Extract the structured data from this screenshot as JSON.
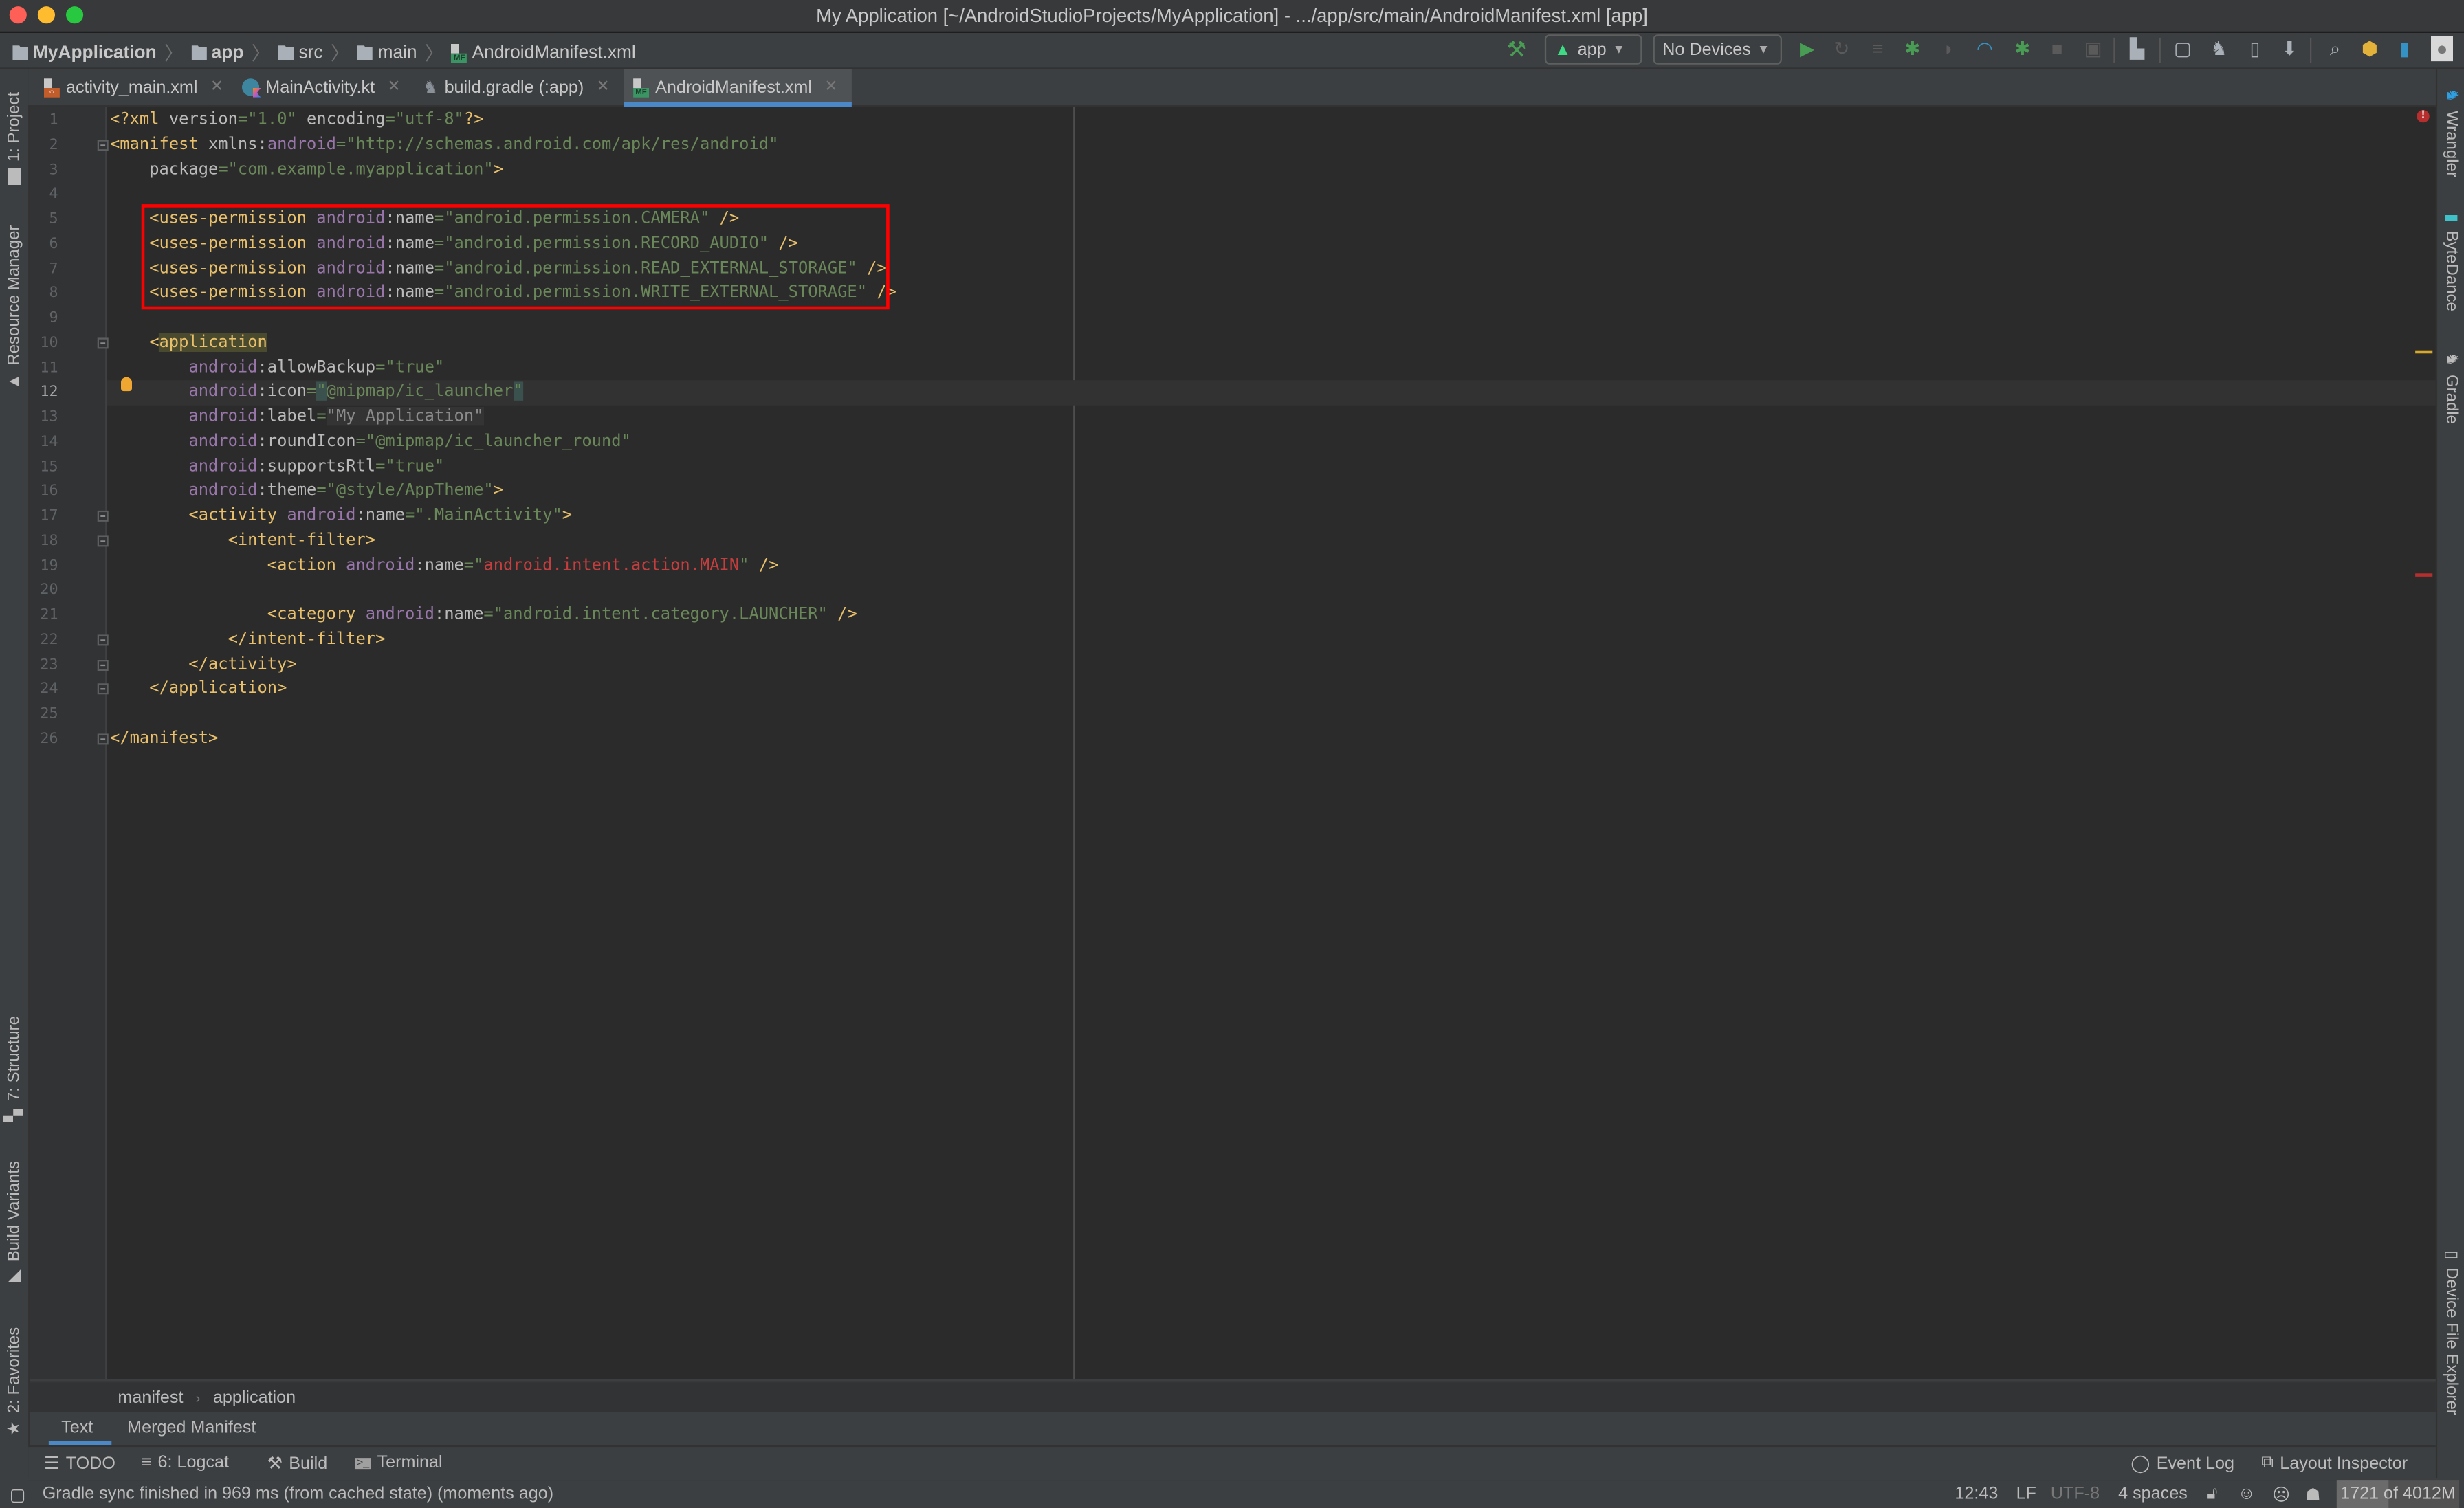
{
  "window": {
    "title": "My Application [~/AndroidStudioProjects/MyApplication] - .../app/src/main/AndroidManifest.xml [app]"
  },
  "navbar": {
    "breadcrumbs": [
      "MyApplication",
      "app",
      "src",
      "main",
      "AndroidManifest.xml"
    ],
    "run_config": "app",
    "device": "No Devices",
    "toolbar_icons": [
      "make-project-icon",
      "run-icon",
      "apply-changes-icon",
      "apply-code-changes-icon",
      "debug-icon",
      "run-with-coverage-icon",
      "profile-icon",
      "attach-debugger-icon",
      "stop-icon",
      "avd-manager-sdk-icon",
      "project-structure-icon",
      "avd-manager-icon",
      "sync-gradle-icon",
      "device-manager-icon",
      "sdk-manager-icon",
      "search-everywhere-icon",
      "plugin-icon",
      "bytedance-icon",
      "user-icon"
    ]
  },
  "tabs": [
    {
      "label": "activity_main.xml",
      "icon": "xml-file-icon",
      "active": false
    },
    {
      "label": "MainActivity.kt",
      "icon": "kotlin-file-icon",
      "active": false
    },
    {
      "label": "build.gradle (:app)",
      "icon": "gradle-file-icon",
      "active": false
    },
    {
      "label": "AndroidManifest.xml",
      "icon": "manifest-file-icon",
      "active": true
    }
  ],
  "left_tool_windows": [
    "1: Project",
    "Resource Manager",
    "7: Structure",
    "Build Variants",
    "2: Favorites"
  ],
  "right_tool_windows": [
    "Wrangler",
    "ByteDance",
    "Gradle",
    "Device File Explorer"
  ],
  "editor": {
    "current_line": 12,
    "lines": [
      {
        "n": 1,
        "tokens": [
          [
            "t-tag",
            "<?xml "
          ],
          [
            "t-attr",
            "version"
          ],
          [
            "t-val",
            "=\"1.0\""
          ],
          [
            "t-attr",
            " encoding"
          ],
          [
            "t-val",
            "=\"utf-8\""
          ],
          [
            "t-tag",
            "?>"
          ]
        ]
      },
      {
        "n": 2,
        "tokens": [
          [
            "t-tag",
            "<manifest "
          ],
          [
            "t-attr",
            "xmlns:"
          ],
          [
            "t-ns",
            "android"
          ],
          [
            "t-val",
            "=\"http://schemas.android.com/apk/res/android\""
          ]
        ]
      },
      {
        "n": 3,
        "tokens": [
          [
            "t-attr",
            "    package"
          ],
          [
            "t-val",
            "=\"com.example.myapplication\""
          ],
          [
            "t-tag",
            ">"
          ]
        ]
      },
      {
        "n": 4,
        "tokens": []
      },
      {
        "n": 5,
        "tokens": [
          [
            "t-tag",
            "    <uses-permission "
          ],
          [
            "t-ns",
            "android"
          ],
          [
            "t-attr",
            ":name"
          ],
          [
            "t-val",
            "=\"android.permission.CAMERA\""
          ],
          [
            "t-tag",
            " />"
          ]
        ]
      },
      {
        "n": 6,
        "tokens": [
          [
            "t-tag",
            "    <uses-permission "
          ],
          [
            "t-ns",
            "android"
          ],
          [
            "t-attr",
            ":name"
          ],
          [
            "t-val",
            "=\"android.permission.RECORD_AUDIO\""
          ],
          [
            "t-tag",
            " />"
          ]
        ]
      },
      {
        "n": 7,
        "tokens": [
          [
            "t-tag",
            "    <uses-permission "
          ],
          [
            "t-ns",
            "android"
          ],
          [
            "t-attr",
            ":name"
          ],
          [
            "t-val",
            "=\"android.permission.READ_EXTERNAL_STORAGE\""
          ],
          [
            "t-tag",
            " />"
          ]
        ]
      },
      {
        "n": 8,
        "tokens": [
          [
            "t-tag",
            "    <uses-permission "
          ],
          [
            "t-ns",
            "android"
          ],
          [
            "t-attr",
            ":name"
          ],
          [
            "t-val",
            "=\"android.permission.WRITE_EXTERNAL_STORAGE\""
          ],
          [
            "t-tag",
            " />"
          ]
        ]
      },
      {
        "n": 9,
        "tokens": []
      },
      {
        "n": 10,
        "tokens": [
          [
            "t-tag",
            "    <"
          ],
          [
            "t-tag t-hl",
            "application"
          ]
        ]
      },
      {
        "n": 11,
        "tokens": [
          [
            "t-ns",
            "        android"
          ],
          [
            "t-attr",
            ":allowBackup"
          ],
          [
            "t-val",
            "=\"true\""
          ]
        ]
      },
      {
        "n": 12,
        "tokens": [
          [
            "t-ns",
            "        android"
          ],
          [
            "t-attr",
            ":icon"
          ],
          [
            "t-val",
            "="
          ],
          [
            "t-val t-sel",
            "\""
          ],
          [
            "t-val",
            "@mipmap/ic_launcher"
          ],
          [
            "t-val t-sel",
            "\""
          ]
        ]
      },
      {
        "n": 13,
        "tokens": [
          [
            "t-ns",
            "        android"
          ],
          [
            "t-attr",
            ":label"
          ],
          [
            "t-val",
            "="
          ],
          [
            "t-lbl",
            "\"My Application\""
          ]
        ]
      },
      {
        "n": 14,
        "tokens": [
          [
            "t-ns",
            "        android"
          ],
          [
            "t-attr",
            ":roundIcon"
          ],
          [
            "t-val",
            "=\"@mipmap/ic_launcher_round\""
          ]
        ]
      },
      {
        "n": 15,
        "tokens": [
          [
            "t-ns",
            "        android"
          ],
          [
            "t-attr",
            ":supportsRtl"
          ],
          [
            "t-val",
            "=\"true\""
          ]
        ]
      },
      {
        "n": 16,
        "tokens": [
          [
            "t-ns",
            "        android"
          ],
          [
            "t-attr",
            ":theme"
          ],
          [
            "t-val",
            "=\"@style/AppTheme\""
          ],
          [
            "t-tag",
            ">"
          ]
        ]
      },
      {
        "n": 17,
        "tokens": [
          [
            "t-tag",
            "        <activity "
          ],
          [
            "t-ns",
            "android"
          ],
          [
            "t-attr",
            ":name"
          ],
          [
            "t-val",
            "=\".MainActivity\""
          ],
          [
            "t-tag",
            ">"
          ]
        ]
      },
      {
        "n": 18,
        "tokens": [
          [
            "t-tag",
            "            <intent-filter>"
          ]
        ]
      },
      {
        "n": 19,
        "tokens": [
          [
            "t-tag",
            "                <action "
          ],
          [
            "t-ns",
            "android"
          ],
          [
            "t-attr",
            ":name"
          ],
          [
            "t-val",
            "=\""
          ],
          [
            "t-err",
            "android.intent.action.MAIN"
          ],
          [
            "t-val",
            "\""
          ],
          [
            "t-tag",
            " />"
          ]
        ]
      },
      {
        "n": 20,
        "tokens": []
      },
      {
        "n": 21,
        "tokens": [
          [
            "t-tag",
            "                <category "
          ],
          [
            "t-ns",
            "android"
          ],
          [
            "t-attr",
            ":name"
          ],
          [
            "t-val",
            "=\"android.intent.category.LAUNCHER\""
          ],
          [
            "t-tag",
            " />"
          ]
        ]
      },
      {
        "n": 22,
        "tokens": [
          [
            "t-tag",
            "            </intent-filter>"
          ]
        ]
      },
      {
        "n": 23,
        "tokens": [
          [
            "t-tag",
            "        </activity>"
          ]
        ]
      },
      {
        "n": 24,
        "tokens": [
          [
            "t-tag",
            "    </application>"
          ]
        ]
      },
      {
        "n": 25,
        "tokens": []
      },
      {
        "n": 26,
        "tokens": [
          [
            "t-tag",
            "</manifest>"
          ]
        ]
      }
    ],
    "fold_lines": [
      2,
      10,
      17,
      18,
      22,
      23,
      24,
      26
    ],
    "highlight_box_lines": [
      5,
      8
    ]
  },
  "editor_breadcrumb": [
    "manifest",
    "application"
  ],
  "subtabs": [
    {
      "label": "Text",
      "active": true
    },
    {
      "label": "Merged Manifest",
      "active": false
    }
  ],
  "tool_buttons_left": [
    {
      "label": "TODO",
      "icon": "todo-list-icon"
    },
    {
      "label": "6: Logcat",
      "icon": "logcat-icon"
    },
    {
      "label": "Build",
      "icon": "hammer-icon"
    },
    {
      "label": "Terminal",
      "icon": "terminal-icon"
    }
  ],
  "tool_buttons_right": [
    {
      "label": "Event Log",
      "icon": "event-log-icon"
    },
    {
      "label": "Layout Inspector",
      "icon": "layout-inspector-icon"
    }
  ],
  "status": {
    "message": "Gradle sync finished in 969 ms (from cached state) (moments ago)",
    "position": "12:43",
    "line_separator": "LF",
    "encoding": "UTF-8",
    "indent": "4 spaces",
    "memory_text": "1721 of 4012M",
    "memory_used_fraction": 0.429
  },
  "colors": {
    "accent": "#4a88c7",
    "highlight_box": "#ff0000",
    "run_green": "#499c54",
    "error_red": "#b72e2e",
    "warning_yellow": "#d7a829"
  }
}
